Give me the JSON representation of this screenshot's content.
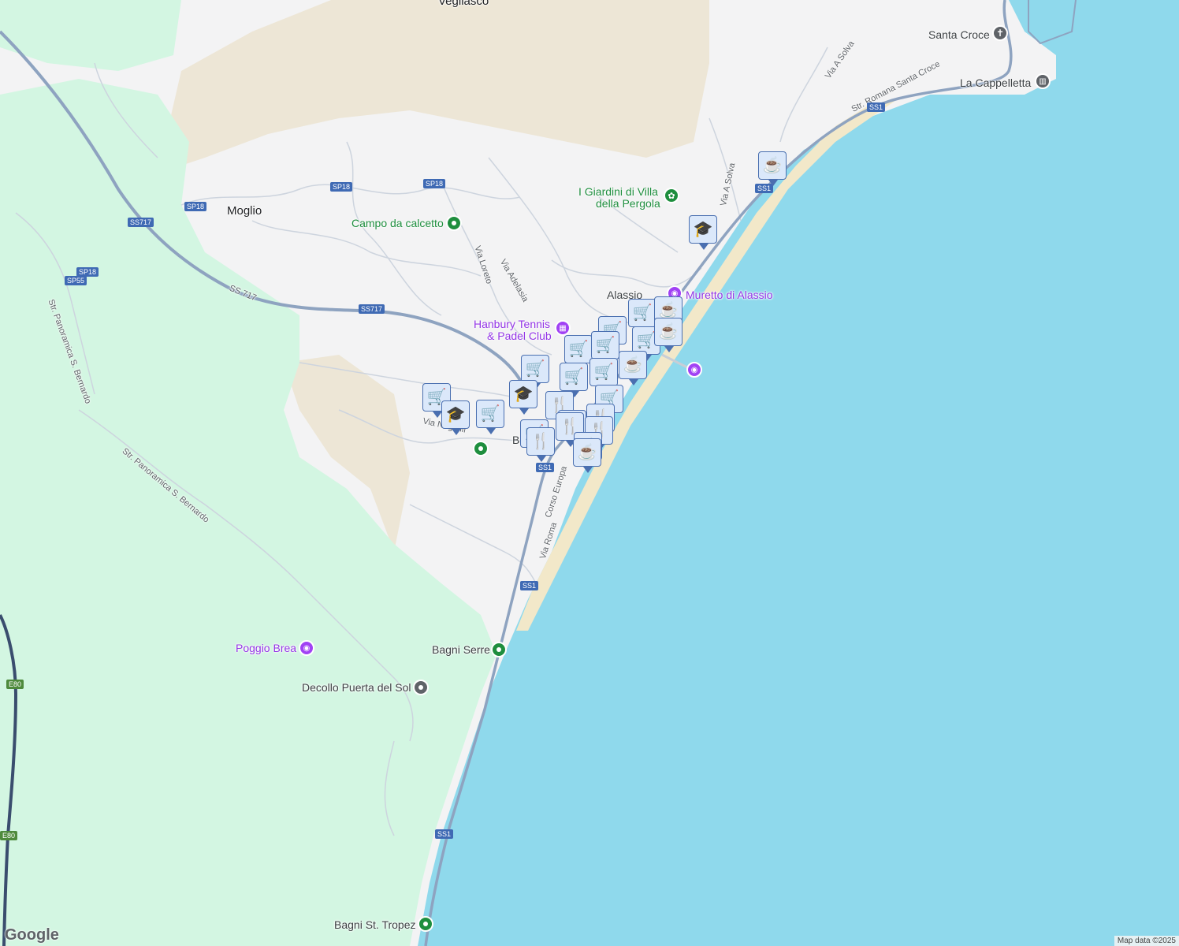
{
  "map": {
    "colors": {
      "sea": "#8fd9ec",
      "land": "#f3f3f4",
      "park": "#d3f6e2",
      "hills": "#ede6d6",
      "road": "#cdd4de",
      "highway": "#8ea3c0",
      "beach": "#f2e8c9",
      "pin_fill": "#dbe8fa",
      "pin_border": "#4a6fb0"
    },
    "places": [
      {
        "name": "Vegliasco",
        "style": "dark"
      },
      {
        "name": "Moglio",
        "style": "dark"
      },
      {
        "name": "Alassio",
        "style": "dark"
      },
      {
        "name": "Santa Croce",
        "style": "dark"
      },
      {
        "name": "La Cappelletta",
        "style": "dark"
      },
      {
        "name": "Campo da calcetto",
        "style": "green"
      },
      {
        "name": "Hanbury Tennis",
        "style": "purple"
      },
      {
        "name": "& Padel Club",
        "style": "purple"
      },
      {
        "name": "Muretto di Alassio",
        "style": "purple"
      },
      {
        "name": "I Giardini di Villa",
        "style": "green"
      },
      {
        "name": "della Pergola",
        "style": "green"
      },
      {
        "name": "Poggio Brea",
        "style": "purple"
      },
      {
        "name": "Decollo Puerta del Sol",
        "style": "dark"
      },
      {
        "name": "Bagni Serre",
        "style": "dark"
      },
      {
        "name": "Bagni St. Tropez",
        "style": "dark"
      },
      {
        "name": "B",
        "style": "dark"
      }
    ],
    "roads": [
      {
        "name": "SS 717"
      },
      {
        "name": "Via Loreto"
      },
      {
        "name": "Via Adelasia"
      },
      {
        "name": "Via A Solva"
      },
      {
        "name": "Via A Solva"
      },
      {
        "name": "Str. Romana Santa Croce"
      },
      {
        "name": "Str. Panoramica S. Bernardo"
      },
      {
        "name": "Str. Panoramica S. Bernardo"
      },
      {
        "name": "Corso Europa"
      },
      {
        "name": "Via Roma"
      },
      {
        "name": "Via Neg elli"
      },
      {
        "name": "SS 717"
      }
    ],
    "shields": [
      "SP18",
      "SP18",
      "SP18",
      "SS717",
      "SS717",
      "SP18",
      "SP55",
      "SS1",
      "SS1",
      "SS1",
      "SS1",
      "SS1",
      "E80",
      "E80"
    ],
    "poi_markers": [
      {
        "icon": "cross-icon",
        "color": "#5f6368"
      },
      {
        "icon": "museum-icon",
        "color": "#5f6368"
      },
      {
        "icon": "flower-icon",
        "color": "#1e8e3e"
      },
      {
        "icon": "stadium-icon",
        "color": "#1e8e3e"
      },
      {
        "icon": "camera-icon",
        "color": "#a142f4"
      },
      {
        "icon": "camera-icon",
        "color": "#a142f4"
      },
      {
        "icon": "building-icon",
        "color": "#a142f4"
      },
      {
        "icon": "camera-icon",
        "color": "#a142f4"
      },
      {
        "icon": "circle-icon",
        "color": "#5f6368"
      },
      {
        "icon": "park-icon",
        "color": "#1e8e3e"
      },
      {
        "icon": "park-icon",
        "color": "#1e8e3e"
      },
      {
        "icon": "park-icon",
        "color": "#1e8e3e"
      }
    ],
    "result_pins": [
      {
        "type": "cafe",
        "glyph": "☕"
      },
      {
        "type": "school",
        "glyph": "🎓"
      },
      {
        "type": "shopping",
        "glyph": "🛒"
      },
      {
        "type": "cafe",
        "glyph": "☕"
      },
      {
        "type": "shopping",
        "glyph": "🛒"
      },
      {
        "type": "cafe",
        "glyph": "☕"
      },
      {
        "type": "shopping",
        "glyph": "🛒"
      },
      {
        "type": "shopping",
        "glyph": "🛒"
      },
      {
        "type": "shopping",
        "glyph": "🛒"
      },
      {
        "type": "cafe",
        "glyph": "☕"
      },
      {
        "type": "shopping",
        "glyph": "🛒"
      },
      {
        "type": "shopping",
        "glyph": "🛒"
      },
      {
        "type": "shopping",
        "glyph": "🛒"
      },
      {
        "type": "school",
        "glyph": "🎓"
      },
      {
        "type": "shopping",
        "glyph": "🛒"
      },
      {
        "type": "school",
        "glyph": "🎓"
      },
      {
        "type": "shopping",
        "glyph": "🛒"
      },
      {
        "type": "restaurant",
        "glyph": "🍴"
      },
      {
        "type": "shopping",
        "glyph": "🛒"
      },
      {
        "type": "restaurant",
        "glyph": "🍴"
      },
      {
        "type": "restaurant",
        "glyph": "🍴"
      },
      {
        "type": "restaurant",
        "glyph": "🍴"
      },
      {
        "type": "shopping",
        "glyph": "🛒"
      },
      {
        "type": "restaurant",
        "glyph": "🍴"
      },
      {
        "type": "restaurant",
        "glyph": "🍴"
      },
      {
        "type": "cafe",
        "glyph": "☕"
      },
      {
        "type": "cafe",
        "glyph": "☕"
      }
    ]
  },
  "footer": {
    "logo": "Google",
    "attribution": "Map data ©2025"
  }
}
